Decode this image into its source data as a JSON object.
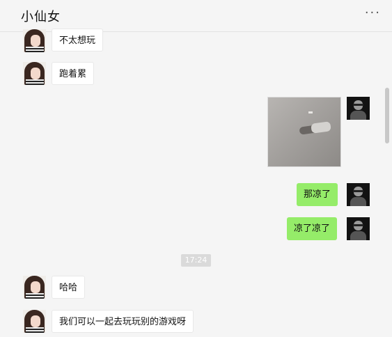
{
  "header": {
    "title": "小仙女",
    "more": "···"
  },
  "messages": [
    {
      "side": "left",
      "text": "不太想玩"
    },
    {
      "side": "left",
      "text": "跑着累"
    },
    {
      "side": "right",
      "type": "image"
    },
    {
      "side": "right",
      "text": "那凉了"
    },
    {
      "side": "right",
      "text": "凉了凉了"
    }
  ],
  "timestamp": "17:24",
  "messages2": [
    {
      "side": "left",
      "text": "哈哈"
    },
    {
      "side": "left",
      "text": "我们可以一起去玩玩别的游戏呀"
    }
  ],
  "colors": {
    "background": "#f5f5f5",
    "self_bubble": "#95ec69",
    "other_bubble": "#ffffff"
  }
}
